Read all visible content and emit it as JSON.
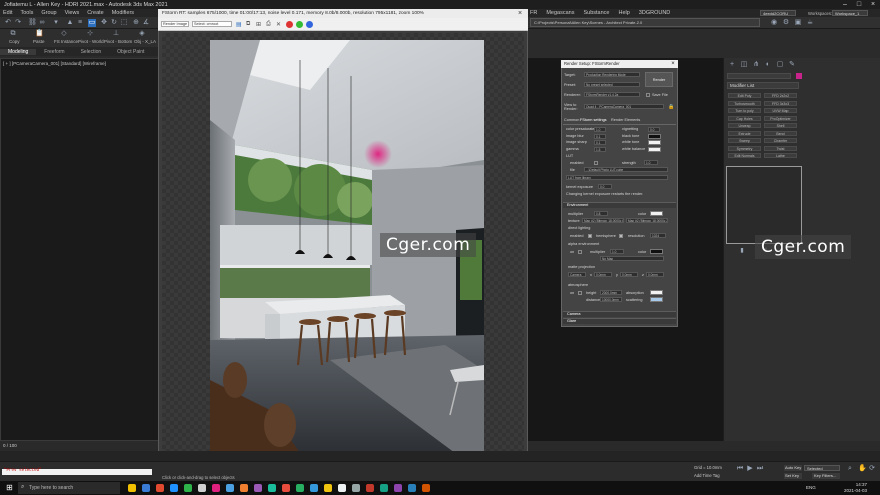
{
  "app": {
    "title": "Jofiatemu L - Allen Key - HDRI 2021.max - Autodesk 3ds Max 2021",
    "workspaces_label": "Workspaces:",
    "workspace_value": "Workspace_1",
    "account_value": "4eedd2CORU"
  },
  "menu": {
    "left": [
      "Edit",
      "Tools",
      "Group",
      "Views",
      "Create",
      "Modifiers",
      "Animation",
      "Graph Editors",
      "Rendering",
      "Civil View",
      "Customize",
      "Scripting"
    ],
    "right": [
      "FR",
      "Megascans",
      "Substance",
      "Help",
      "3DGROUND"
    ],
    "path": "C:\\Projects\\Personal\\Allen Key\\Scenes - Architect Private-2.0"
  },
  "ribbon": {
    "tools": [
      "Copy",
      "Paste",
      "FS Instance",
      "Pivot - World",
      "Pivot - Bottom",
      "Obj - X_LA"
    ],
    "tabs": [
      "Modeling",
      "Freeform",
      "Selection",
      "Object Paint",
      "Populate"
    ]
  },
  "viewport": {
    "label": "[ + ] [PCameraCamera_001] [Standard] [Wireframe]"
  },
  "framebuffer": {
    "title": "FStorm RT: samples 675/1000, time 01:00/17:13, noise level 0.171, memory 8.0b/8.000b, resolution 795x1181, zoom 100%",
    "toolbar_select_1": "Render Image",
    "toolbar_select_2": "Select: cmroot",
    "status": "None Selected",
    "hint": "Click or click-and-drag to select objects"
  },
  "render_setup": {
    "title": "Render Setup: FStormRender",
    "target_label": "Target:",
    "target_value": "Production Rendering Mode",
    "preset_label": "Preset:",
    "preset_value": "No preset selected",
    "renderer_label": "Renderer:",
    "renderer_value": "FStormRender v1.4.2a",
    "save_file_label": "Save File",
    "view_label": "View to Render:",
    "view_value": "Quad 4 - PCameraCamera_001",
    "render_button": "Render",
    "tabs": [
      "Common",
      "FStorm settings",
      "Render Elements"
    ],
    "color_rows": [
      {
        "label": "color presaturate",
        "value": "1.0",
        "label2": "vignetting",
        "value2": "0.0"
      },
      {
        "label": "image blur",
        "value": "0.1",
        "label2": "black tone",
        "value2": ""
      },
      {
        "label": "image sharp",
        "value": "0.1",
        "label2": "white tone",
        "value2": ""
      },
      {
        "label": "gamma",
        "value": "1.5",
        "label2": "white balance",
        "value2": ""
      }
    ],
    "lut_label": "LUT",
    "lut_enabled": "enabled",
    "lut_strength_label": "strength",
    "lut_strength": "1.0",
    "lut_file_label": "file",
    "lut_file": "...\\Default Photo LUT.cube",
    "lut_library": "LUT from library",
    "kernel_exposure_label": "kernel exposure",
    "kernel_exposure_value": "0.0",
    "kernel_note": "Changing kernel exposure restarts the render.",
    "env_header": "Environment",
    "multiplier_label": "multiplier",
    "multiplier_value": "0.8",
    "color_label": "color",
    "texture_label": "texture",
    "texture_value": "Map #2 (Bitmap: 18.0000c 6171)",
    "texture_value2": "Map #2 (Bitmap: 18.0000c 2b 1)",
    "direct_lighting": "direct lighting",
    "enabled_label": "enabled",
    "hemisphere_label": "hemisphere",
    "resolution_label": "resolution",
    "resolution_value": "1024",
    "alpha_env": "alpha environment",
    "on_label": "on",
    "alpha_multiplier_label": "multiplier",
    "alpha_multiplier_value": "1.0",
    "alpha_color_label": "color",
    "alpha_texture_value": "No Map",
    "matte_label": "matte projection",
    "matte_camera": "Camera",
    "x_label": "x",
    "x_value": "0.0mm",
    "y_label": "y",
    "y_value": "0.0mm",
    "z_label": "z",
    "z_value": "0.0mm",
    "atmosphere_label": "atmosphere",
    "height_label": "height",
    "height_value": "2000.0mm",
    "absorption_label": "absorption",
    "distance_label": "distance",
    "distance_value": "10000.0mm",
    "scattering_label": "scattering",
    "camera_header": "Camera",
    "glare_header": "Glare"
  },
  "command_panel": {
    "modifier_list": "Modifier List",
    "buttons": [
      "Edit Poly",
      "FFD 2x2x2",
      "Turbosmooth",
      "FFD 3x3x3",
      "Turn to poly",
      "UVW Map",
      "Cap Holes",
      "ProOptimizer",
      "Unwrap",
      "Shell",
      "Extrude",
      "Bend",
      "Sweep",
      "Chamfer",
      "Symmetry",
      "Twist",
      "Edit Normals",
      "Lathe"
    ]
  },
  "watermarks": [
    "Cger.com",
    "Cger.com"
  ],
  "status": {
    "maxscript": "\"Prev selected\"",
    "selection": "None Selected",
    "grid": "Grid = 10.0mm",
    "addtime": "Add Time Tag",
    "autokey": "Auto Key",
    "selected": "Selected",
    "setkey": "Set Key",
    "filters": "Key Filters..."
  },
  "timeline": {
    "frame": "0 / 100"
  },
  "taskbar": {
    "search_placeholder": "Type here to search",
    "lang": "ENG",
    "time": "14:37",
    "date": "2021-04-03"
  },
  "colors": {
    "accent": "#2d6fbf",
    "magenta": "#c8238a",
    "swatch_white": "#f2f2f2",
    "swatch_black": "#111111",
    "swatch_blue": "#a8c8e8"
  }
}
